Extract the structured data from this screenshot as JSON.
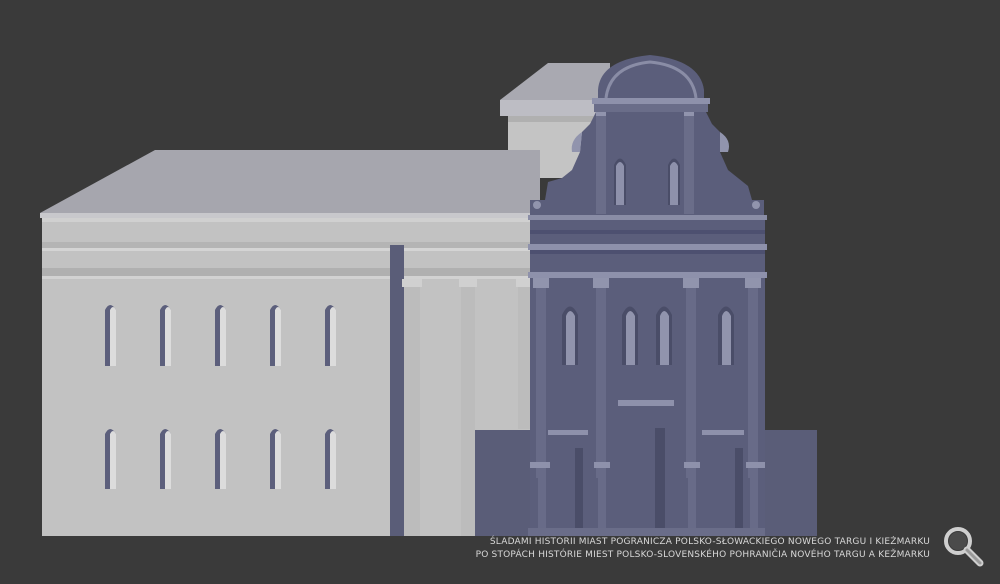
{
  "viewer": {
    "background_color": "#3a3a3a",
    "model_colors": {
      "light_wall": "#c0c0c0",
      "roof": "#a4a4ac",
      "facade": "#5b5e7b",
      "facade_highlight": "#9194ad"
    }
  },
  "caption": {
    "line1": "ŚLADAMI HISTORII MIAST POGRANICZA POLSKO-SŁOWACKIEGO NOWEGO TARGU I KIEŻMARKU",
    "line2": "PO STOPÁCH HISTÓRIE MIEST POLSKO-SLOVENSKÉHO POHRANIČIA NOVÉHO TARGU A KEŽMARKU"
  },
  "controls": {
    "zoom_icon": "magnifier-icon"
  }
}
